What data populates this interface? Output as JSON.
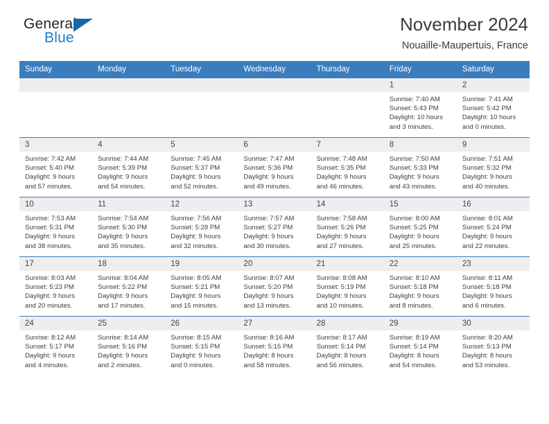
{
  "logo": {
    "word_top": "General",
    "word_bottom": "Blue",
    "triangle_icon": "triangle-icon"
  },
  "header": {
    "title": "November 2024",
    "subtitle": "Nouaille-Maupertuis, France"
  },
  "calendar": {
    "weekday_headers": [
      "Sunday",
      "Monday",
      "Tuesday",
      "Wednesday",
      "Thursday",
      "Friday",
      "Saturday"
    ],
    "accent_color": "#3a7dbf",
    "daynum_bg": "#eeeeee",
    "weeks": [
      [
        {
          "day": "",
          "empty": true
        },
        {
          "day": "",
          "empty": true
        },
        {
          "day": "",
          "empty": true
        },
        {
          "day": "",
          "empty": true
        },
        {
          "day": "",
          "empty": true
        },
        {
          "day": "1",
          "sunrise": "Sunrise: 7:40 AM",
          "sunset": "Sunset: 5:43 PM",
          "daylight_1": "Daylight: 10 hours",
          "daylight_2": "and 3 minutes."
        },
        {
          "day": "2",
          "sunrise": "Sunrise: 7:41 AM",
          "sunset": "Sunset: 5:42 PM",
          "daylight_1": "Daylight: 10 hours",
          "daylight_2": "and 0 minutes."
        }
      ],
      [
        {
          "day": "3",
          "sunrise": "Sunrise: 7:42 AM",
          "sunset": "Sunset: 5:40 PM",
          "daylight_1": "Daylight: 9 hours",
          "daylight_2": "and 57 minutes."
        },
        {
          "day": "4",
          "sunrise": "Sunrise: 7:44 AM",
          "sunset": "Sunset: 5:39 PM",
          "daylight_1": "Daylight: 9 hours",
          "daylight_2": "and 54 minutes."
        },
        {
          "day": "5",
          "sunrise": "Sunrise: 7:45 AM",
          "sunset": "Sunset: 5:37 PM",
          "daylight_1": "Daylight: 9 hours",
          "daylight_2": "and 52 minutes."
        },
        {
          "day": "6",
          "sunrise": "Sunrise: 7:47 AM",
          "sunset": "Sunset: 5:36 PM",
          "daylight_1": "Daylight: 9 hours",
          "daylight_2": "and 49 minutes."
        },
        {
          "day": "7",
          "sunrise": "Sunrise: 7:48 AM",
          "sunset": "Sunset: 5:35 PM",
          "daylight_1": "Daylight: 9 hours",
          "daylight_2": "and 46 minutes."
        },
        {
          "day": "8",
          "sunrise": "Sunrise: 7:50 AM",
          "sunset": "Sunset: 5:33 PM",
          "daylight_1": "Daylight: 9 hours",
          "daylight_2": "and 43 minutes."
        },
        {
          "day": "9",
          "sunrise": "Sunrise: 7:51 AM",
          "sunset": "Sunset: 5:32 PM",
          "daylight_1": "Daylight: 9 hours",
          "daylight_2": "and 40 minutes."
        }
      ],
      [
        {
          "day": "10",
          "sunrise": "Sunrise: 7:53 AM",
          "sunset": "Sunset: 5:31 PM",
          "daylight_1": "Daylight: 9 hours",
          "daylight_2": "and 38 minutes."
        },
        {
          "day": "11",
          "sunrise": "Sunrise: 7:54 AM",
          "sunset": "Sunset: 5:30 PM",
          "daylight_1": "Daylight: 9 hours",
          "daylight_2": "and 35 minutes."
        },
        {
          "day": "12",
          "sunrise": "Sunrise: 7:56 AM",
          "sunset": "Sunset: 5:28 PM",
          "daylight_1": "Daylight: 9 hours",
          "daylight_2": "and 32 minutes."
        },
        {
          "day": "13",
          "sunrise": "Sunrise: 7:57 AM",
          "sunset": "Sunset: 5:27 PM",
          "daylight_1": "Daylight: 9 hours",
          "daylight_2": "and 30 minutes."
        },
        {
          "day": "14",
          "sunrise": "Sunrise: 7:58 AM",
          "sunset": "Sunset: 5:26 PM",
          "daylight_1": "Daylight: 9 hours",
          "daylight_2": "and 27 minutes."
        },
        {
          "day": "15",
          "sunrise": "Sunrise: 8:00 AM",
          "sunset": "Sunset: 5:25 PM",
          "daylight_1": "Daylight: 9 hours",
          "daylight_2": "and 25 minutes."
        },
        {
          "day": "16",
          "sunrise": "Sunrise: 8:01 AM",
          "sunset": "Sunset: 5:24 PM",
          "daylight_1": "Daylight: 9 hours",
          "daylight_2": "and 22 minutes."
        }
      ],
      [
        {
          "day": "17",
          "sunrise": "Sunrise: 8:03 AM",
          "sunset": "Sunset: 5:23 PM",
          "daylight_1": "Daylight: 9 hours",
          "daylight_2": "and 20 minutes."
        },
        {
          "day": "18",
          "sunrise": "Sunrise: 8:04 AM",
          "sunset": "Sunset: 5:22 PM",
          "daylight_1": "Daylight: 9 hours",
          "daylight_2": "and 17 minutes."
        },
        {
          "day": "19",
          "sunrise": "Sunrise: 8:05 AM",
          "sunset": "Sunset: 5:21 PM",
          "daylight_1": "Daylight: 9 hours",
          "daylight_2": "and 15 minutes."
        },
        {
          "day": "20",
          "sunrise": "Sunrise: 8:07 AM",
          "sunset": "Sunset: 5:20 PM",
          "daylight_1": "Daylight: 9 hours",
          "daylight_2": "and 13 minutes."
        },
        {
          "day": "21",
          "sunrise": "Sunrise: 8:08 AM",
          "sunset": "Sunset: 5:19 PM",
          "daylight_1": "Daylight: 9 hours",
          "daylight_2": "and 10 minutes."
        },
        {
          "day": "22",
          "sunrise": "Sunrise: 8:10 AM",
          "sunset": "Sunset: 5:18 PM",
          "daylight_1": "Daylight: 9 hours",
          "daylight_2": "and 8 minutes."
        },
        {
          "day": "23",
          "sunrise": "Sunrise: 8:11 AM",
          "sunset": "Sunset: 5:18 PM",
          "daylight_1": "Daylight: 9 hours",
          "daylight_2": "and 6 minutes."
        }
      ],
      [
        {
          "day": "24",
          "sunrise": "Sunrise: 8:12 AM",
          "sunset": "Sunset: 5:17 PM",
          "daylight_1": "Daylight: 9 hours",
          "daylight_2": "and 4 minutes."
        },
        {
          "day": "25",
          "sunrise": "Sunrise: 8:14 AM",
          "sunset": "Sunset: 5:16 PM",
          "daylight_1": "Daylight: 9 hours",
          "daylight_2": "and 2 minutes."
        },
        {
          "day": "26",
          "sunrise": "Sunrise: 8:15 AM",
          "sunset": "Sunset: 5:15 PM",
          "daylight_1": "Daylight: 9 hours",
          "daylight_2": "and 0 minutes."
        },
        {
          "day": "27",
          "sunrise": "Sunrise: 8:16 AM",
          "sunset": "Sunset: 5:15 PM",
          "daylight_1": "Daylight: 8 hours",
          "daylight_2": "and 58 minutes."
        },
        {
          "day": "28",
          "sunrise": "Sunrise: 8:17 AM",
          "sunset": "Sunset: 5:14 PM",
          "daylight_1": "Daylight: 8 hours",
          "daylight_2": "and 56 minutes."
        },
        {
          "day": "29",
          "sunrise": "Sunrise: 8:19 AM",
          "sunset": "Sunset: 5:14 PM",
          "daylight_1": "Daylight: 8 hours",
          "daylight_2": "and 54 minutes."
        },
        {
          "day": "30",
          "sunrise": "Sunrise: 8:20 AM",
          "sunset": "Sunset: 5:13 PM",
          "daylight_1": "Daylight: 8 hours",
          "daylight_2": "and 53 minutes."
        }
      ]
    ]
  }
}
